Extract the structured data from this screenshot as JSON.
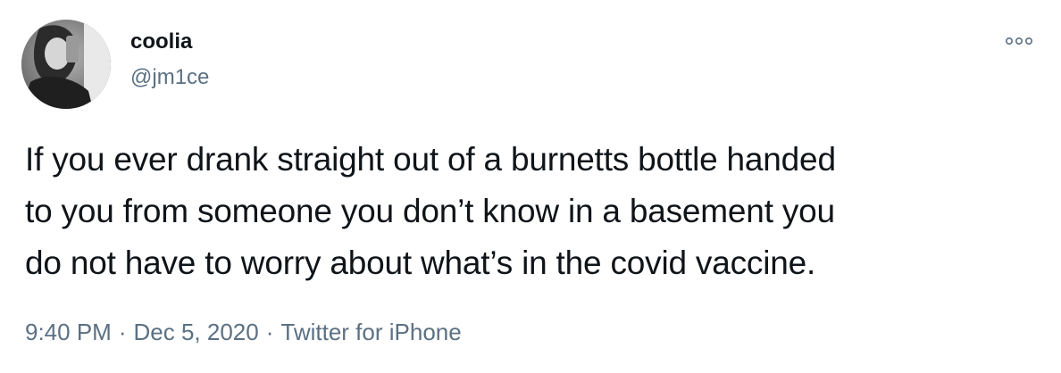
{
  "user": {
    "display_name": "coolia",
    "handle": "@jm1ce"
  },
  "tweet": {
    "lines": [
      "If you ever drank straight out of a burnetts bottle handed",
      "to you from someone you don’t know in a basement you",
      "do not have to worry about what’s in the covid vaccine."
    ]
  },
  "meta": {
    "time": "9:40 PM",
    "separator": "·",
    "date": "Dec 5, 2020",
    "source": "Twitter for iPhone"
  },
  "icons": {
    "more": "more-options-icon",
    "avatar": "profile-avatar"
  },
  "colors": {
    "text": "#0f1419",
    "secondary": "#5b7083"
  }
}
